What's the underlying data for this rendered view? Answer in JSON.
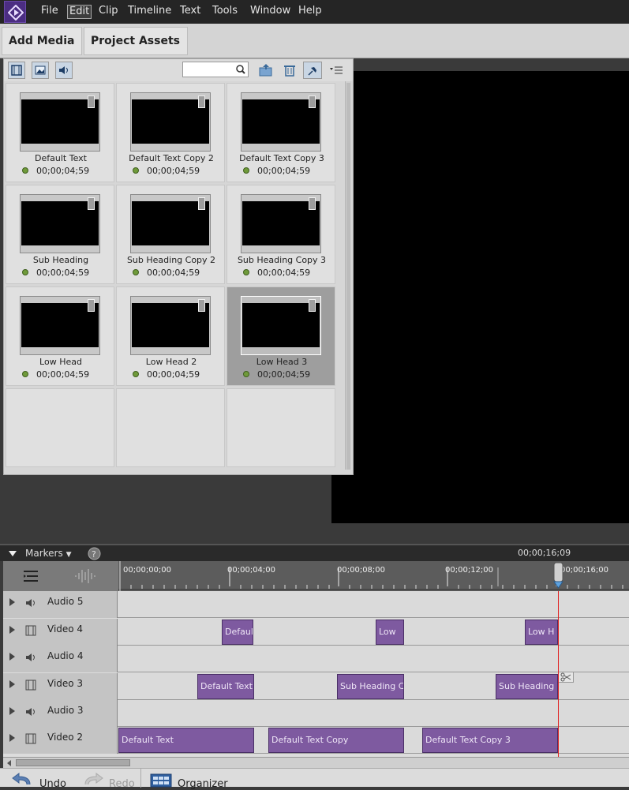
{
  "menu": {
    "items": [
      "File",
      "Edit",
      "Clip",
      "Timeline",
      "Text",
      "Tools",
      "Window",
      "Help"
    ],
    "active": "Edit"
  },
  "panel_tabs": {
    "add_media": "Add Media",
    "project_assets": "Project Assets"
  },
  "assets": {
    "search_value": "",
    "items": [
      {
        "name": "Default Text",
        "duration": "00;00;04;59"
      },
      {
        "name": "Default Text Copy 2",
        "duration": "00;00;04;59"
      },
      {
        "name": "Default Text Copy 3",
        "duration": "00;00;04;59"
      },
      {
        "name": "Sub Heading",
        "duration": "00;00;04;59"
      },
      {
        "name": "Sub Heading Copy 2",
        "duration": "00;00;04;59"
      },
      {
        "name": "Sub Heading Copy 3",
        "duration": "00;00;04;59"
      },
      {
        "name": "Low Head",
        "duration": "00;00;04;59"
      },
      {
        "name": "Low Head 2",
        "duration": "00;00;04;59"
      },
      {
        "name": "Low Head 3",
        "duration": "00;00;04;59",
        "selected": true
      }
    ]
  },
  "timeline": {
    "markers_label": "Markers",
    "current_time": "00;00;16;09",
    "ruler": [
      "00;00;00;00",
      "00;00;04;00",
      "00;00;08;00",
      "00;00;12;00",
      "00;00;16;00"
    ],
    "tracks": [
      {
        "name": "Audio 5",
        "type": "audio",
        "clips": []
      },
      {
        "name": "Video 4",
        "type": "video",
        "clips": [
          "Defaul",
          "Low",
          "Low H"
        ]
      },
      {
        "name": "Audio 4",
        "type": "audio",
        "clips": []
      },
      {
        "name": "Video 3",
        "type": "video",
        "clips": [
          "Default Text",
          "Sub Heading Co",
          "Sub Heading C"
        ]
      },
      {
        "name": "Audio 3",
        "type": "audio",
        "clips": []
      },
      {
        "name": "Video 2",
        "type": "video",
        "clips": [
          "Default Text",
          "Default Text Copy",
          "Default Text Copy 3"
        ]
      }
    ]
  },
  "bottom": {
    "undo": "Undo",
    "redo": "Redo",
    "organizer": "Organizer"
  },
  "colors": {
    "clip": "#7e5aa0",
    "playhead": "#e02020",
    "brand": "#4b2d82"
  }
}
